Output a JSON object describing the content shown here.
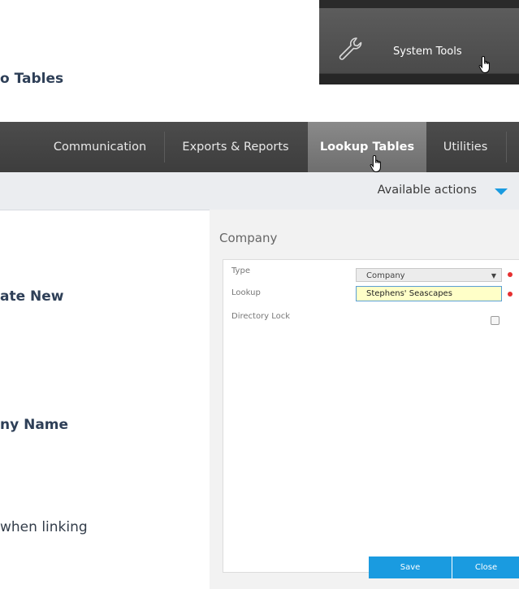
{
  "document": {
    "fragment_lookup_tables": "o Tables",
    "fragment_create_new": "ate New",
    "fragment_company_name": "ny Name",
    "fragment_linking": "when linking"
  },
  "system_tools": {
    "label": "System Tools",
    "icon": "wrench-icon"
  },
  "nav": {
    "tabs": [
      {
        "label": "Communication"
      },
      {
        "label": "Exports & Reports"
      },
      {
        "label": "Lookup Tables",
        "active": true
      },
      {
        "label": "Utilities"
      }
    ]
  },
  "actions": {
    "label": "Available actions",
    "accent": "#1a9be0"
  },
  "panel": {
    "title": "Company",
    "fields": {
      "type_label": "Type",
      "type_value": "Company",
      "lookup_label": "Lookup",
      "lookup_value": "Stephens' Seascapes",
      "directory_lock_label": "Directory Lock",
      "directory_lock_checked": false
    },
    "buttons": {
      "save": "Save",
      "close": "Close"
    }
  },
  "colors": {
    "required": "#e63030",
    "button": "#1a9be0",
    "nav_bg": "#444444"
  }
}
